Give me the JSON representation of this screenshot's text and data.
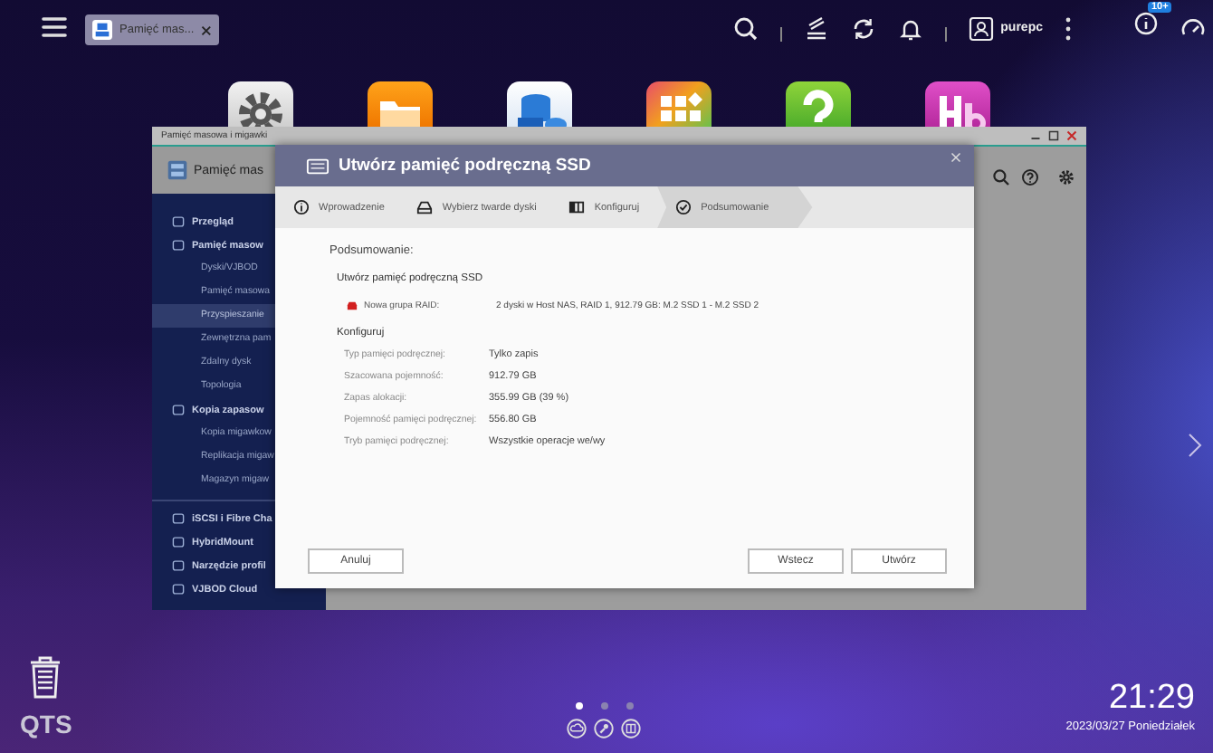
{
  "top_bar": {
    "tabs": [
      {
        "label": "Pamięć mas...",
        "selected": true
      }
    ],
    "username": "purepc",
    "notification_badge": "10+"
  },
  "storage_window": {
    "title": "Pamięć masowa i migawki",
    "app_name": "Pamięć mas",
    "sidebar": [
      {
        "label": "Przegląd",
        "selected": false
      },
      {
        "label": "Pamięć masow",
        "selected": false,
        "children": [
          {
            "label": "Dyski/VJBOD",
            "selected": false
          },
          {
            "label": "Pamięć masowa",
            "selected": false
          },
          {
            "label": "Przyspieszanie",
            "selected": true
          },
          {
            "label": "Zewnętrzna pam",
            "selected": false
          },
          {
            "label": "Zdalny dysk",
            "selected": false
          },
          {
            "label": "Topologia",
            "selected": false
          }
        ]
      },
      {
        "label": "Kopia zapasow",
        "selected": false,
        "children": [
          {
            "label": "Kopia migawkow",
            "selected": false
          },
          {
            "label": "Replikacja migaw",
            "selected": false
          },
          {
            "label": "Magazyn migaw",
            "selected": false
          }
        ]
      },
      {
        "label": "iSCSI i Fibre Cha",
        "selected": false
      },
      {
        "label": "HybridMount",
        "selected": false
      },
      {
        "label": "Narzędzie profil",
        "selected": false
      },
      {
        "label": "VJBOD Cloud",
        "selected": false
      }
    ]
  },
  "dialog": {
    "title": "Utwórz pamięć podręczną SSD",
    "steps": [
      {
        "label": "Wprowadzenie",
        "selected": false
      },
      {
        "label": "Wybierz twarde dyski",
        "selected": false
      },
      {
        "label": "Konfiguruj",
        "selected": false
      },
      {
        "label": "Podsumowanie",
        "selected": true
      }
    ],
    "summary_heading": "Podsumowanie:",
    "section_title": "Utwórz pamięć podręczną SSD",
    "raid": {
      "label": "Nowa grupa RAID:",
      "value": "2 dyski w Host NAS, RAID 1, 912.79 GB: M.2 SSD 1 - M.2 SSD 2"
    },
    "config_heading": "Konfiguruj",
    "config_rows": [
      {
        "label": "Typ pamięci podręcznej:",
        "value": "Tylko zapis"
      },
      {
        "label": "Szacowana pojemność:",
        "value": "912.79 GB"
      },
      {
        "label": "Zapas alokacji:",
        "value": "355.99 GB (39 %)"
      },
      {
        "label": "Pojemność pamięci podręcznej:",
        "value": "556.80 GB"
      },
      {
        "label": "Tryb pamięci podręcznej:",
        "value": "Wszystkie operacje we/wy"
      }
    ],
    "buttons": {
      "cancel": "Anuluj",
      "back": "Wstecz",
      "create": "Utwórz"
    }
  },
  "desktop": {
    "page_dots": [
      {
        "selected": true
      },
      {
        "selected": false
      },
      {
        "selected": false
      }
    ],
    "logo": "QTS",
    "time": "21:29",
    "date": "2023/03/27 Poniedziałek"
  }
}
